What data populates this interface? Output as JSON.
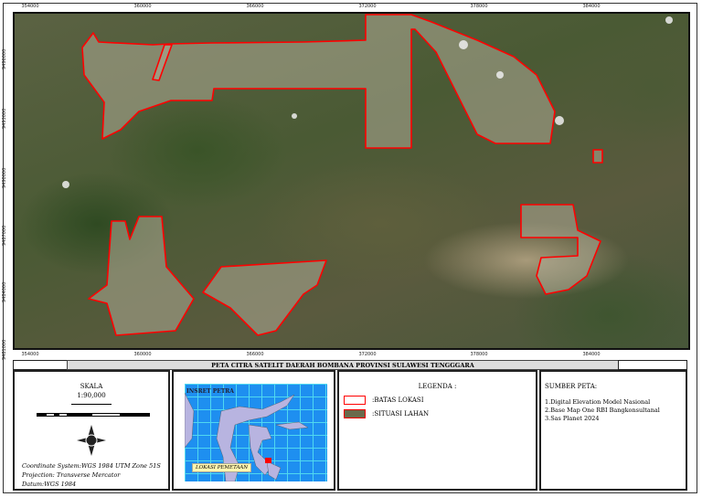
{
  "map": {
    "x_ticks": [
      "354000",
      "360000",
      "366000",
      "372000",
      "378000",
      "384000"
    ],
    "y_ticks": [
      "9496000",
      "9493000",
      "9490000",
      "9487000",
      "9484000",
      "9481000"
    ],
    "boundary_color": "#ff0000"
  },
  "title": "PETA CITRA SATELIT DAERAH BOMBANA PROVINSI SULAWESI TENGGGARA",
  "scale": {
    "heading": "SKALA",
    "ratio": "1:90,000"
  },
  "projection": {
    "coordinate_system": "Coordinate System:WGS 1984 UTM Zone 51S",
    "projection": "Projection: Transverse Mercator",
    "datum": "Datum:WGS 1984"
  },
  "inset": {
    "title": "INSRET PETRA",
    "location_label": "LOKASI PEMETAAN",
    "sea_color": "#1e8ff0",
    "land_color": "#b8b4e0"
  },
  "legend": {
    "heading": "LEGENDA :",
    "items": [
      ":BATAS LOKASI",
      ":SITUASI LAHAN"
    ]
  },
  "sources": {
    "heading": "SUMBER PETA:",
    "items": [
      "1.Digital Elevation Model Nasional",
      "2.Base Map One RBI Bangkonsultanal",
      "3.Sas Planet 2024"
    ]
  }
}
